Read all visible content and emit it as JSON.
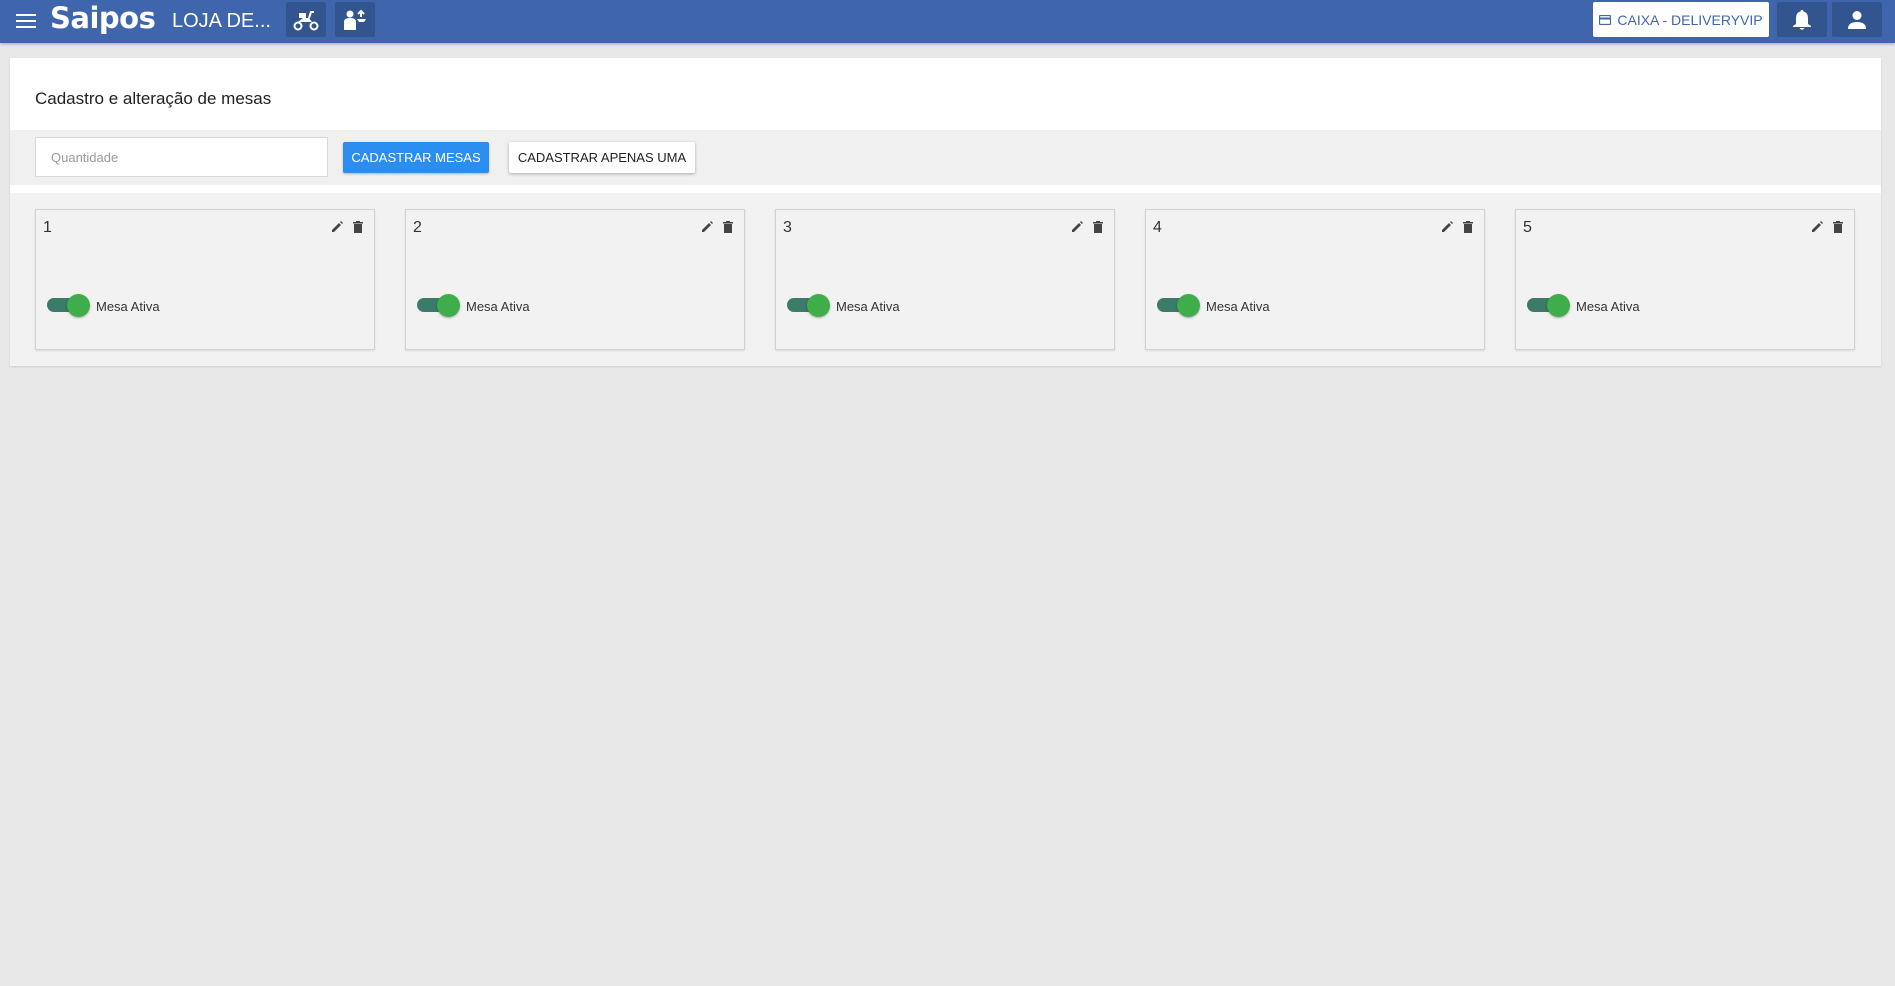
{
  "header": {
    "logo": "Saipos",
    "store_name": "LOJA DE...",
    "delivery_icon": "delivery-motorbike-icon",
    "waiter_icon": "waiter-icon",
    "caixa_label": "CAIXA - DELIVERYVIP",
    "caixa_icon": "card-icon",
    "notifications_icon": "bell-icon",
    "user_icon": "person-icon",
    "colors": {
      "bar": "#3f66ad",
      "button": "#33558f"
    }
  },
  "page": {
    "title": "Cadastro e alteração de mesas",
    "quantity_placeholder": "Quantidade",
    "quantity_value": "",
    "register_tables_label": "CADASTRAR MESAS",
    "register_one_label": "CADASTRAR APENAS UMA"
  },
  "tables": [
    {
      "number": "1",
      "status_label": "Mesa Ativa",
      "active": true
    },
    {
      "number": "2",
      "status_label": "Mesa Ativa",
      "active": true
    },
    {
      "number": "3",
      "status_label": "Mesa Ativa",
      "active": true
    },
    {
      "number": "4",
      "status_label": "Mesa Ativa",
      "active": true
    },
    {
      "number": "5",
      "status_label": "Mesa Ativa",
      "active": true
    }
  ],
  "colors": {
    "primary_button": "#2c8df0",
    "toggle_on": "#3fae4a"
  }
}
